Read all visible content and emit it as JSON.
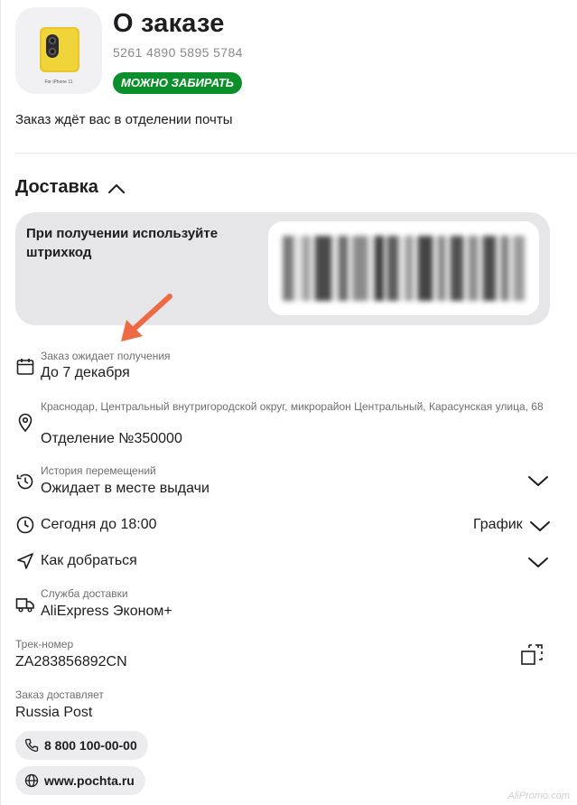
{
  "header": {
    "title": "О заказе",
    "order_number": "5261 4890 5895 5784",
    "status_badge": "МОЖНО ЗАБИРАТЬ",
    "thumb_caption": "For iPhone 11",
    "description": "Заказ ждёт вас в отделении почты"
  },
  "delivery": {
    "section_title": "Доставка",
    "barcode_prompt": "При получении используйте штрихкод",
    "awaiting": {
      "label": "Заказ ожидает получения",
      "value": "До 7 декабря"
    },
    "address": {
      "label": "Краснодар, Центральный внутригородской округ, микрорайон Центральный, Карасунская улица, 68",
      "value": "Отделение №350000"
    },
    "history": {
      "label": "История перемещений",
      "value": "Ожидает в месте выдачи"
    },
    "hours": {
      "value": "Сегодня до 18:00",
      "schedule_label": "График"
    },
    "directions": {
      "value": "Как добраться"
    },
    "service": {
      "label": "Служба доставки",
      "value": "AliExpress Эконом+"
    },
    "tracking": {
      "label": "Трек-номер",
      "value": "ZA283856892CN"
    },
    "carrier": {
      "label": "Заказ доставляет",
      "value": "Russia Post"
    },
    "phone": "8 800 100-00-00",
    "website": "www.pochta.ru"
  },
  "watermark": "AliPromo.com",
  "colors": {
    "badge_green": "#0a8f2b",
    "arrow": "#ee6a44",
    "card_bg": "#e6e6e8"
  },
  "icons": [
    "calendar-icon",
    "location-pin-icon",
    "history-icon",
    "clock-icon",
    "navigation-arrow-icon",
    "delivery-truck-icon",
    "copy-icon",
    "phone-icon",
    "globe-icon",
    "chevron-up-icon",
    "chevron-down-icon"
  ]
}
